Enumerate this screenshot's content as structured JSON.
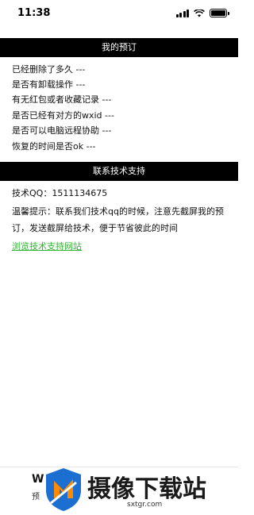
{
  "status_bar": {
    "time": "11:38"
  },
  "sections": {
    "reservation_title": "我的预订",
    "reservation_items": [
      "已经删除了多久  ---",
      "是否有卸载操作  ---",
      "有无红包或者收藏记录  ---",
      "是否已经有对方的wxid  ---",
      "是否可以电脑远程协助  ---",
      "恢复的时间是否ok  ---"
    ],
    "support_title": "联系技术支持",
    "qq_line": "技术QQ：1511134675",
    "tip_text": "温馨提示：联系我们技术qq的时候，注意先截屏我的预订，发送截屏给技术，便于节省彼此的时间",
    "link_text": "浏览技术支持网站"
  },
  "bottom": {
    "title_partial": "W",
    "sub_partial": "预"
  },
  "watermark": {
    "text": "摄像下载站",
    "url": "sxtgr.com"
  }
}
